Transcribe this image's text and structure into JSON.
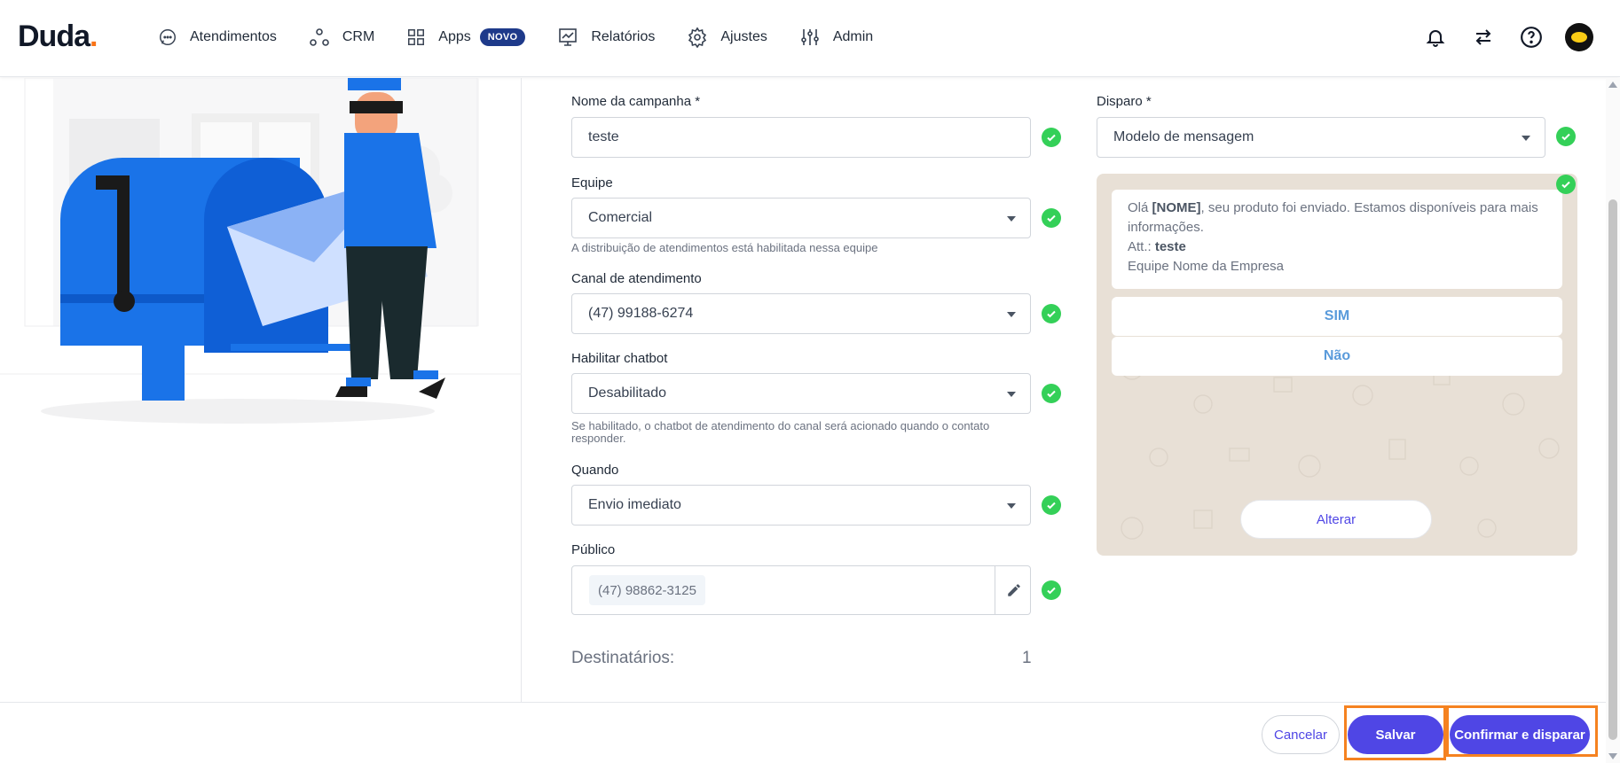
{
  "header": {
    "logo": "Duda",
    "logo_dot": ".",
    "nav": [
      {
        "label": "Atendimentos",
        "icon": "chat-bubble-icon"
      },
      {
        "label": "CRM",
        "icon": "crm-nodes-icon"
      },
      {
        "label": "Apps",
        "icon": "apps-grid-icon",
        "badge": "NOVO"
      },
      {
        "label": "Relatórios",
        "icon": "reports-chart-icon"
      },
      {
        "label": "Ajustes",
        "icon": "gear-icon"
      },
      {
        "label": "Admin",
        "icon": "sliders-icon"
      }
    ],
    "right_icons": [
      "bell-icon",
      "swap-arrows-icon",
      "help-circle-icon"
    ],
    "avatar": "avatar"
  },
  "form": {
    "campaign_name": {
      "label": "Nome da campanha *",
      "value": "teste"
    },
    "team": {
      "label": "Equipe",
      "value": "Comercial",
      "hint": "A distribuição de atendimentos está habilitada nessa equipe"
    },
    "channel": {
      "label": "Canal de atendimento",
      "value": "(47) 99188-6274"
    },
    "chatbot": {
      "label": "Habilitar chatbot",
      "value": "Desabilitado",
      "hint": "Se habilitado, o chatbot de atendimento do canal será acionado quando o contato responder."
    },
    "when": {
      "label": "Quando",
      "value": "Envio imediato"
    },
    "audience": {
      "label": "Público",
      "chip": "(47) 98862-3125"
    },
    "recipients": {
      "label": "Destinatários:",
      "count": "1"
    },
    "trigger": {
      "label": "Disparo *",
      "value": "Modelo de mensagem"
    }
  },
  "preview": {
    "msg_prefix": "Olá ",
    "msg_name": "[NOME]",
    "msg_rest": ", seu produto foi enviado. Estamos disponíveis para mais informações.",
    "att_prefix": "Att.: ",
    "att_name": "teste",
    "signature": "Equipe Nome da Empresa",
    "reply_yes": "SIM",
    "reply_no": "Não",
    "alter": "Alterar"
  },
  "footer": {
    "cancel": "Cancelar",
    "save": "Salvar",
    "confirm": "Confirmar e disparar"
  },
  "colors": {
    "primary": "#4f46e5",
    "success": "#34d058",
    "highlight": "#f58220",
    "brand_dot": "#f97316"
  }
}
